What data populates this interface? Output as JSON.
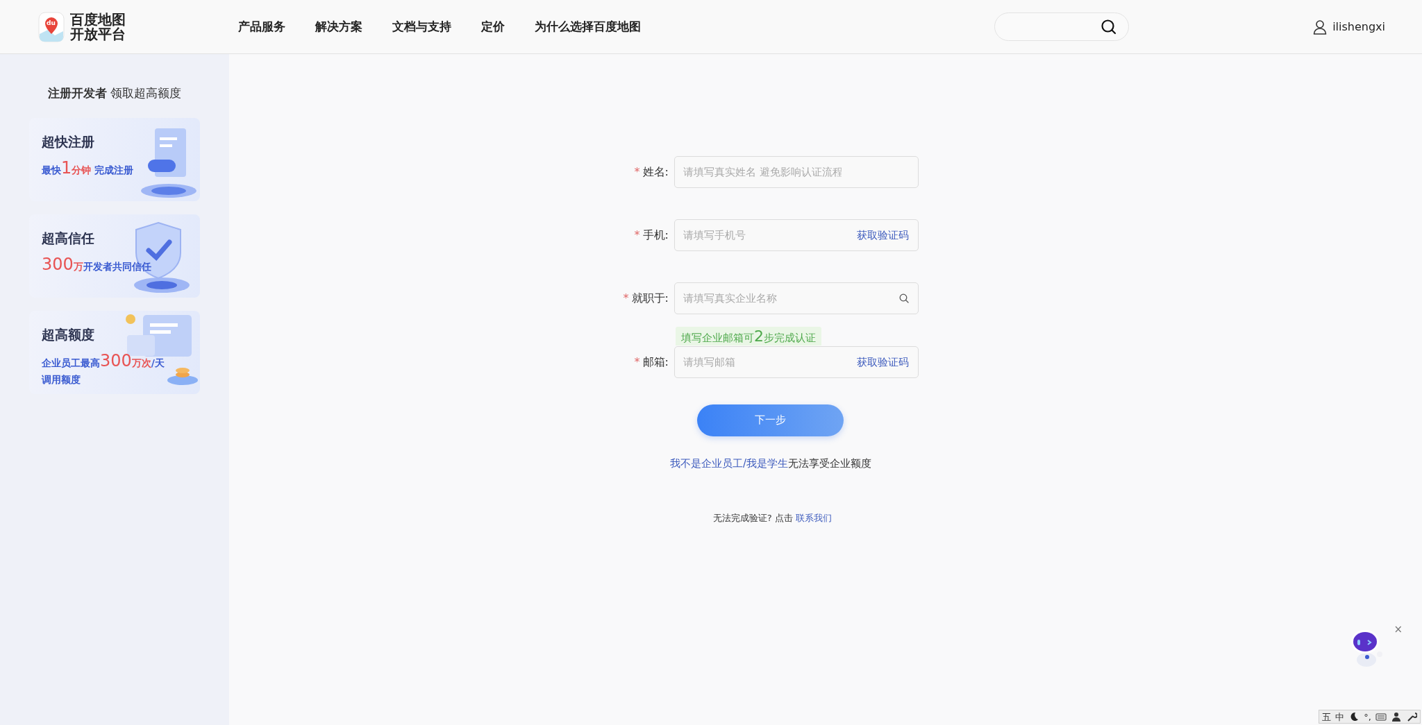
{
  "header": {
    "logo": {
      "badge": "du",
      "line1": "百度地图",
      "line2": "开放平台"
    },
    "nav": [
      {
        "label": "产品服务"
      },
      {
        "label": "解决方案"
      },
      {
        "label": "文档与支持"
      },
      {
        "label": "定价"
      },
      {
        "label": "为什么选择百度地图"
      }
    ],
    "user": {
      "name": "ilishengxi"
    }
  },
  "sidebar": {
    "title": "**注册开发者** 领取超高额度",
    "cards": [
      {
        "kind": "register",
        "heading": "超快注册",
        "lines": [
          [
            {
              "text": "最快",
              "kind": "plain"
            },
            {
              "text": "1",
              "kind": "big"
            },
            {
              "text": "分钟",
              "kind": "accent"
            },
            {
              "text": " 完成注册",
              "kind": "plain"
            }
          ]
        ]
      },
      {
        "kind": "trust",
        "heading": "超高信任",
        "lines": [
          [
            {
              "text": "300",
              "kind": "big"
            },
            {
              "text": "万",
              "kind": "accent"
            },
            {
              "text": "开发者共同信任",
              "kind": "plain"
            }
          ]
        ]
      },
      {
        "kind": "quota",
        "heading": "超高额度",
        "lines": [
          [
            {
              "text": "企业员工最高",
              "kind": "plain"
            },
            {
              "text": "300",
              "kind": "big"
            },
            {
              "text": "万次",
              "kind": "accent"
            },
            {
              "text": "/天",
              "kind": "plain"
            }
          ],
          [
            {
              "text": "调用额度",
              "kind": "plain"
            }
          ]
        ]
      }
    ]
  },
  "form": {
    "required_mark": "*",
    "fields": [
      {
        "label": "姓名:",
        "required": true,
        "placeholder": "请填写真实姓名 避免影响认证流程",
        "kind": "plain"
      },
      {
        "label": "手机:",
        "required": true,
        "placeholder": "请填写手机号",
        "kind": "code",
        "action": "获取验证码"
      },
      {
        "label": "就职于:",
        "required": true,
        "placeholder": "请填写真实企业名称",
        "kind": "search"
      },
      {
        "label": "邮箱:",
        "required": true,
        "placeholder": "请填写邮箱",
        "kind": "code",
        "action": "获取验证码",
        "hint": [
          {
            "text": "填写企业邮箱可",
            "kind": "plain"
          },
          {
            "text": "2",
            "kind": "big"
          },
          {
            "text": "步完成认证",
            "kind": "plain"
          }
        ]
      }
    ],
    "submit": "下一步",
    "alt": {
      "link": "我不是企业员工/我是学生",
      "text": "无法享受企业额度"
    },
    "help": {
      "text": "无法完成验证? 点击 ",
      "link": "联系我们"
    }
  },
  "assistant": {
    "close": "×"
  },
  "ime_bar": {
    "items": [
      {
        "kind": "text",
        "label": "五"
      },
      {
        "kind": "text",
        "label": "中"
      },
      {
        "kind": "moon"
      },
      {
        "kind": "text",
        "label": "°,"
      },
      {
        "kind": "keyboard"
      },
      {
        "kind": "person"
      },
      {
        "kind": "wrench"
      }
    ]
  }
}
